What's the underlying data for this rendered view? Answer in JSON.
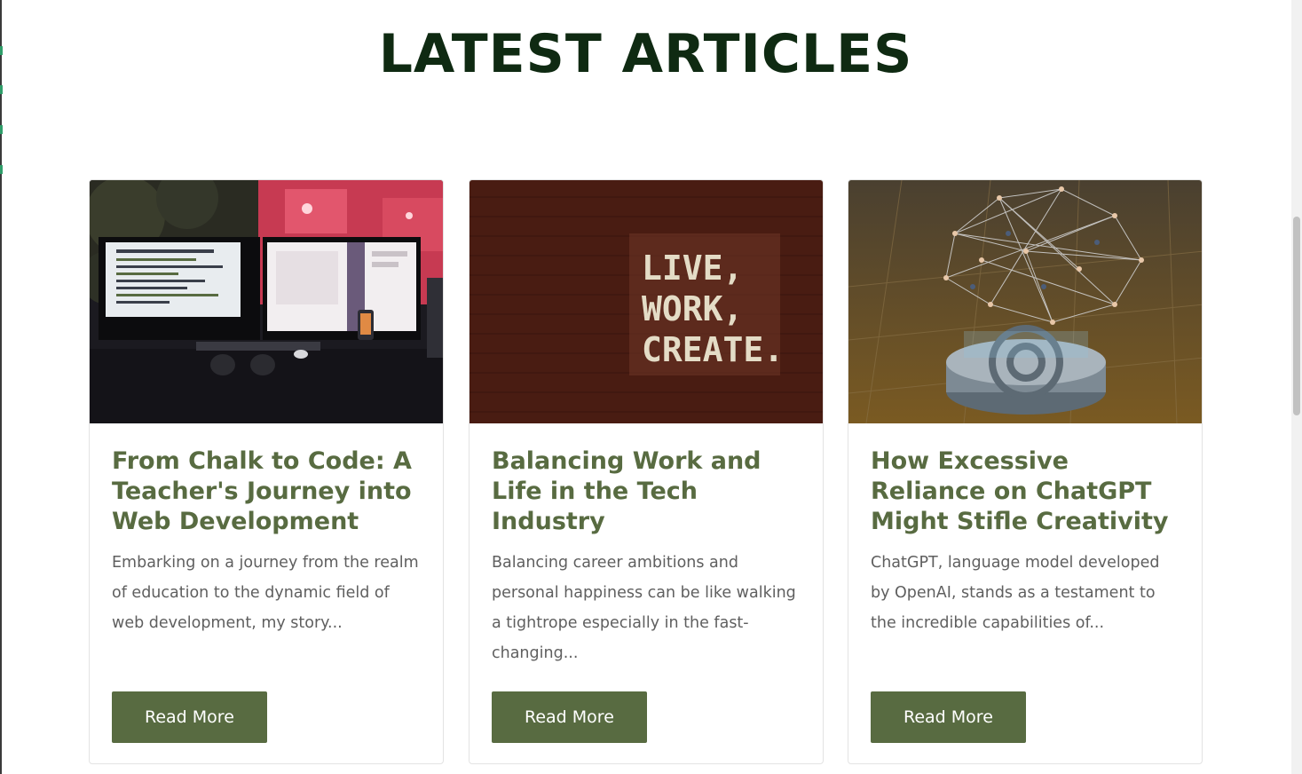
{
  "section": {
    "title": "LATEST ARTICLES"
  },
  "articles": [
    {
      "image_label": "monitors-desk-photo",
      "title": "From Chalk to Code: A Teacher's Journey into Web Development",
      "excerpt": "Embarking on a journey from the realm of education to the dynamic field of web development, my story...",
      "button_label": "Read More"
    },
    {
      "image_label": "live-work-create-wall-photo",
      "image_text_lines": [
        "LIVE,",
        "WORK,",
        "CREATE."
      ],
      "title": "Balancing Work and Life in the Tech Industry",
      "excerpt": "Balancing career ambitions and personal happiness can be like walking a tightrope especially in the fast-changing...",
      "button_label": "Read More"
    },
    {
      "image_label": "ai-network-brain-photo",
      "title": "How Excessive Reliance on ChatGPT Might Stifle Creativity",
      "excerpt": "ChatGPT, language model developed by OpenAI, stands as a testament to the incredible capabilities of...",
      "button_label": "Read More"
    }
  ],
  "colors": {
    "heading": "#0f2a12",
    "accent": "#586b41",
    "text": "#5f5f5f",
    "button_text": "#ffffff"
  }
}
